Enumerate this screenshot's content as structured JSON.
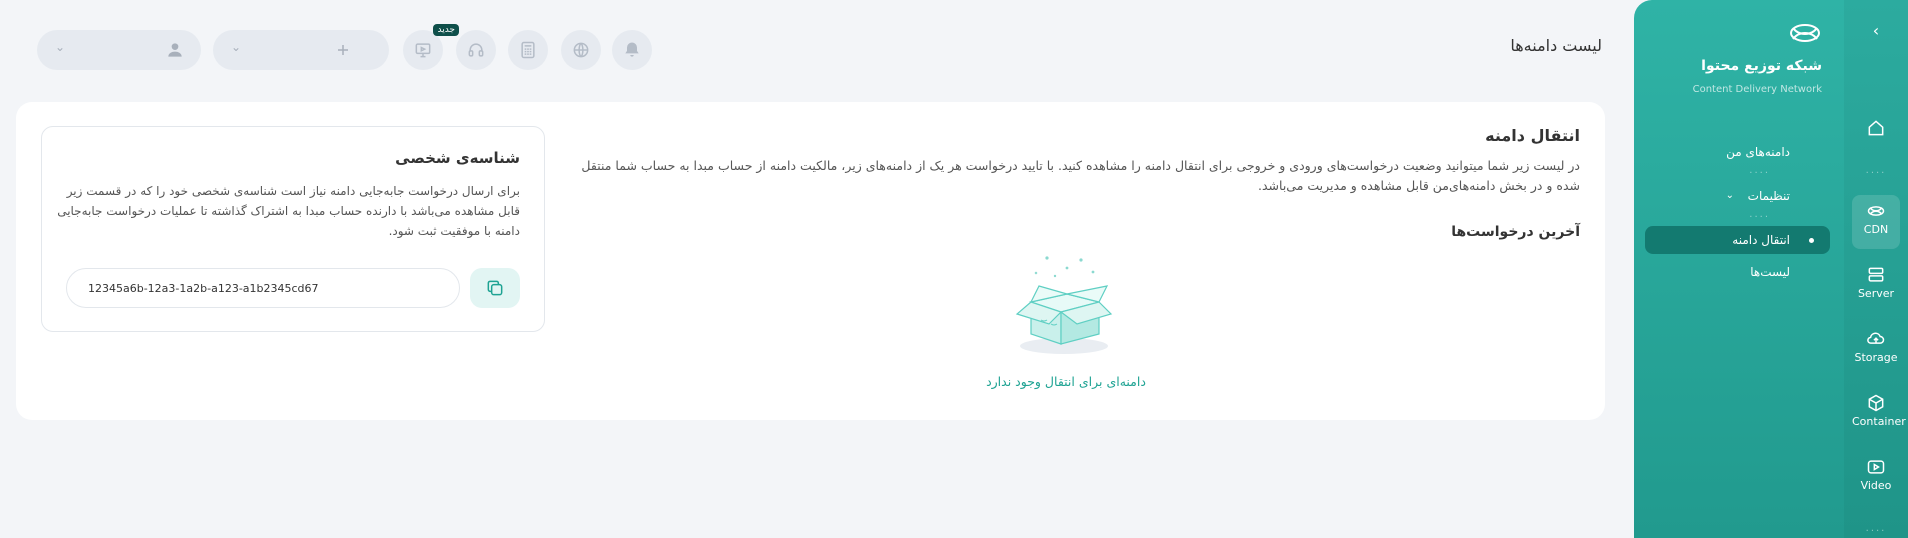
{
  "page": {
    "title": "لیست دامنه‌ها"
  },
  "sidebar": {
    "title": "شبکه توزیع محتوا",
    "subtitle": "Content Delivery Network",
    "items": [
      {
        "label": "دامنه‌های من"
      },
      {
        "label": "تنظیمات"
      },
      {
        "label": "انتقال دامنه",
        "active": true
      },
      {
        "label": "لیست‌ها"
      }
    ]
  },
  "rail": {
    "items": [
      {
        "label": "",
        "icon": "home-icon"
      },
      {
        "label": "CDN",
        "icon": "cdn-icon",
        "active": true
      },
      {
        "label": "Server",
        "icon": "server-icon"
      },
      {
        "label": "Storage",
        "icon": "storage-icon"
      },
      {
        "label": "Container",
        "icon": "container-icon"
      },
      {
        "label": "Video",
        "icon": "video-icon"
      }
    ]
  },
  "header": {
    "new_badge": "جدید",
    "icons": [
      "notification-bell-icon",
      "globe-icon",
      "calculator-icon",
      "headset-icon",
      "presentation-icon"
    ]
  },
  "transfer": {
    "title": "انتقال دامنه",
    "description": "در لیست زیر شما میتوانید وضعیت درخواست‌های ورودی و خروجی برای انتقال دامنه را مشاهده کنید. با تایید درخواست هر یک از دامنه‌های زیر، مالکیت دامنه از حساب مبدا به حساب شما منتقل شده و در بخش دامنه‌های‌من قابل مشاهده و مدیریت می‌باشد.",
    "recent_title": "آخرین درخواست‌ها",
    "empty_text": "دامنه‌ای برای انتقال وجود ندارد"
  },
  "personal_id": {
    "title": "شناسه‌ی شخصی",
    "description": "برای ارسال درخواست جابه‌جایی دامنه نیاز است شناسه‌ی شخصی خود را که در قسمت زیر قابل مشاهده می‌باشد با دارنده حساب مبدا به اشتراک گذاشته تا عملیات درخواست جابه‌جایی دامنه با موفقیت ثبت شود.",
    "value": "12345a6b-12a3-1a2b-a123-a1b2345cd67"
  },
  "colors": {
    "accent": "#2cab9f",
    "accent_dark": "#137a70",
    "empty_text": "#1ea393",
    "background": "#f3f5f8"
  }
}
